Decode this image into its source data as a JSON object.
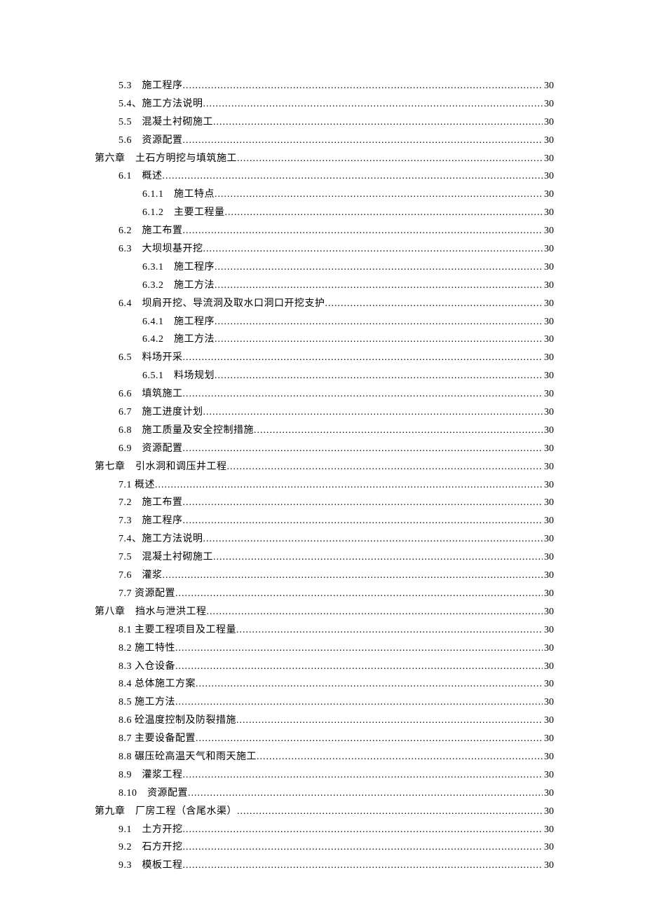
{
  "toc": [
    {
      "level": 1,
      "label": "5.3　施工程序",
      "page": "30"
    },
    {
      "level": 1,
      "label": "5.4、施工方法说明",
      "page": "30"
    },
    {
      "level": 1,
      "label": "5.5　混凝土衬砌施工",
      "page": "30"
    },
    {
      "level": 1,
      "label": "5.6　资源配置",
      "page": "30"
    },
    {
      "level": 0,
      "label": "第六章　土石方明挖与填筑施工",
      "page": "30"
    },
    {
      "level": 1,
      "label": "6.1　概述",
      "page": "30"
    },
    {
      "level": 2,
      "label": "6.1.1　施工特点",
      "page": "30"
    },
    {
      "level": 2,
      "label": "6.1.2　主要工程量",
      "page": "30"
    },
    {
      "level": 1,
      "label": "6.2　施工布置",
      "page": "30"
    },
    {
      "level": 1,
      "label": "6.3　大坝坝基开挖",
      "page": "30"
    },
    {
      "level": 2,
      "label": "6.3.1　施工程序",
      "page": "30"
    },
    {
      "level": 2,
      "label": "6.3.2　施工方法",
      "page": "30"
    },
    {
      "level": 1,
      "label": "6.4　坝肩开挖、导流洞及取水口洞口开挖支护",
      "page": "30"
    },
    {
      "level": 2,
      "label": "6.4.1　施工程序",
      "page": "30"
    },
    {
      "level": 2,
      "label": "6.4.2　施工方法",
      "page": "30"
    },
    {
      "level": 1,
      "label": "6.5　料场开采",
      "page": "30"
    },
    {
      "level": 2,
      "label": "6.5.1　料场规划",
      "page": "30"
    },
    {
      "level": 1,
      "label": "6.6　填筑施工",
      "page": "30"
    },
    {
      "level": 1,
      "label": "6.7　施工进度计划",
      "page": "30"
    },
    {
      "level": 1,
      "label": "6.8　施工质量及安全控制措施",
      "page": "30"
    },
    {
      "level": 1,
      "label": "6.9　资源配置",
      "page": "30"
    },
    {
      "level": 0,
      "label": "第七章　引水洞和调压井工程",
      "page": "30"
    },
    {
      "level": 1,
      "label": "7.1 概述",
      "page": "30"
    },
    {
      "level": 1,
      "label": "7.2　施工布置",
      "page": "30"
    },
    {
      "level": 1,
      "label": "7.3　施工程序",
      "page": "30"
    },
    {
      "level": 1,
      "label": "7.4、施工方法说明",
      "page": "30"
    },
    {
      "level": 1,
      "label": "7.5　混凝土衬砌施工",
      "page": "30"
    },
    {
      "level": 1,
      "label": "7.6　灌浆",
      "page": "30"
    },
    {
      "level": 1,
      "label": "7.7 资源配置",
      "page": "30"
    },
    {
      "level": 0,
      "label": "第八章　挡水与泄洪工程",
      "page": "30"
    },
    {
      "level": 1,
      "label": "8.1 主要工程项目及工程量",
      "page": "30"
    },
    {
      "level": 1,
      "label": "8.2 施工特性",
      "page": "30"
    },
    {
      "level": 1,
      "label": "8.3 入仓设备",
      "page": "30"
    },
    {
      "level": 1,
      "label": "8.4 总体施工方案",
      "page": "30"
    },
    {
      "level": 1,
      "label": "8.5 施工方法",
      "page": "30"
    },
    {
      "level": 1,
      "label": "8.6 砼温度控制及防裂措施",
      "page": "30"
    },
    {
      "level": 1,
      "label": "8.7 主要设备配置",
      "page": "30"
    },
    {
      "level": 1,
      "label": "8.8 碾压砼高温天气和雨天施工",
      "page": "30"
    },
    {
      "level": 1,
      "label": "8.9　灌浆工程",
      "page": "30"
    },
    {
      "level": 1,
      "label": "8.10　资源配置",
      "page": "30"
    },
    {
      "level": 0,
      "label": "第九章　厂房工程（含尾水渠）",
      "page": "30"
    },
    {
      "level": 1,
      "label": "9.1　土方开挖",
      "page": "30"
    },
    {
      "level": 1,
      "label": "9.2　石方开挖",
      "page": "30"
    },
    {
      "level": 1,
      "label": "9.3　模板工程",
      "page": "30"
    }
  ]
}
